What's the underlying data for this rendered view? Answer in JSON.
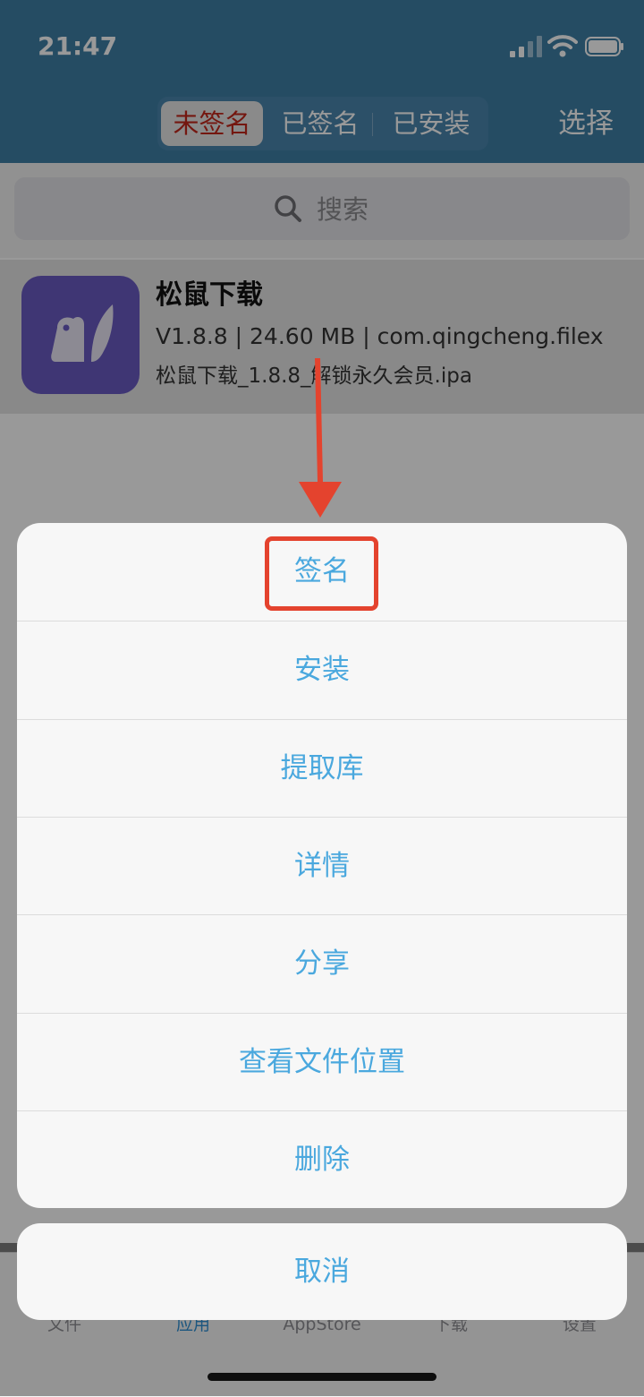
{
  "status_bar": {
    "time": "21:47"
  },
  "header": {
    "segments": [
      "未签名",
      "已签名",
      "已安装"
    ],
    "selected_segment": 0,
    "select_label": "选择"
  },
  "search": {
    "placeholder": "搜索"
  },
  "app": {
    "name": "松鼠下载",
    "meta": "V1.8.8 | 24.60 MB | com.qingcheng.filex",
    "file": "松鼠下载_1.8.8_解锁永久会员.ipa"
  },
  "action_sheet": {
    "actions": [
      "签名",
      "安装",
      "提取库",
      "详情",
      "分享",
      "查看文件位置",
      "删除"
    ],
    "cancel": "取消"
  },
  "tab_bar": {
    "tabs": [
      "文件",
      "应用",
      "AppStore",
      "下载",
      "设置"
    ],
    "active": 1
  },
  "colors": {
    "header": "#3f7fa6",
    "accent": "#4aa8de",
    "selected_segment_text": "#c2271c",
    "annotation": "#e4432e",
    "app_icon": "#6a5bc2"
  }
}
